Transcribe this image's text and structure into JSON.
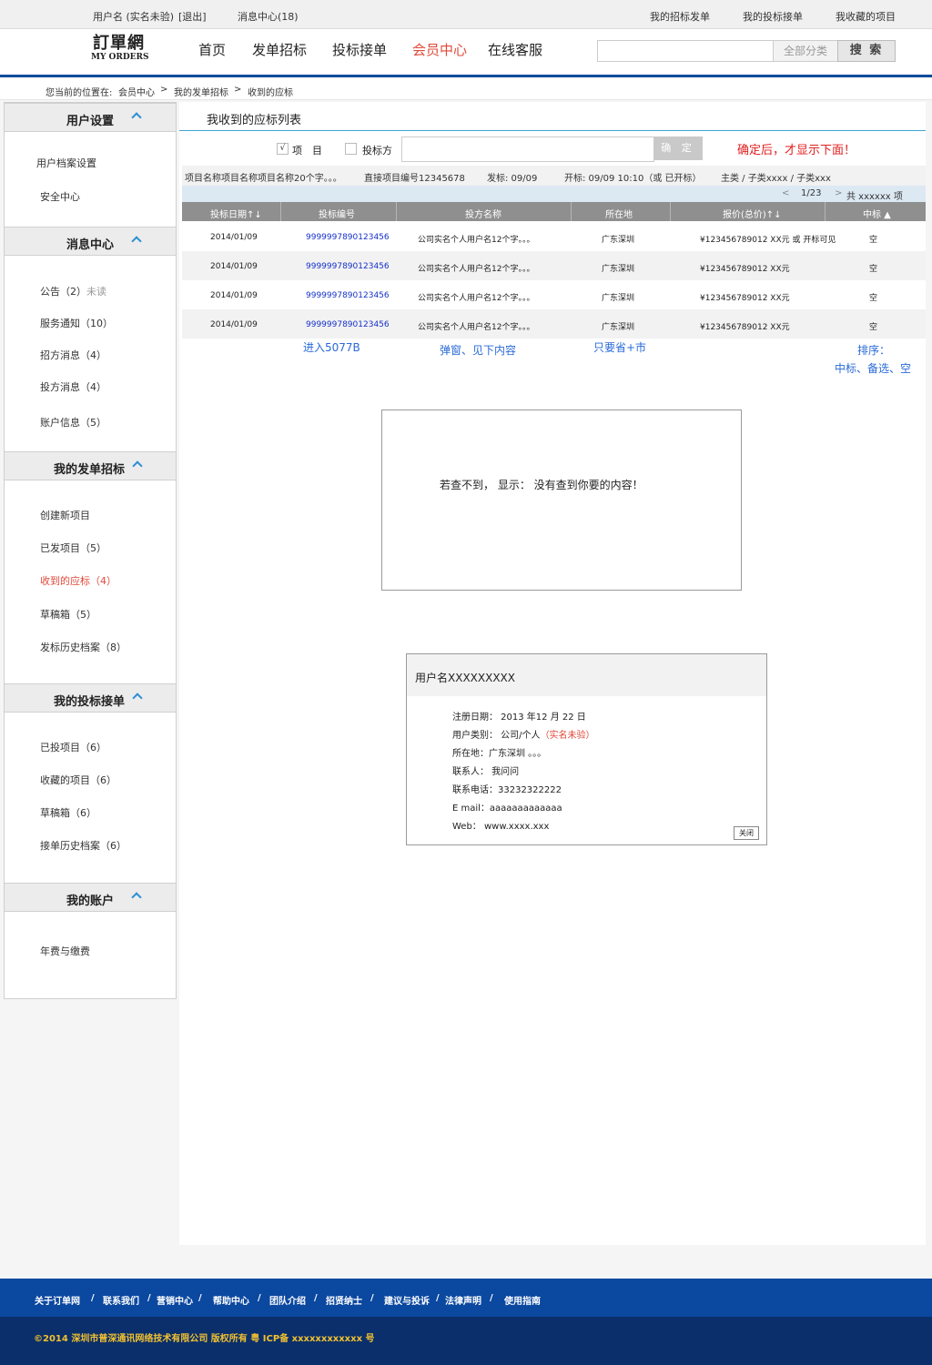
{
  "topbar": {
    "user": "用户名 (实名未验)",
    "logout": "[退出]",
    "messages": "消息中心(18)",
    "my_bids_posted": "我的招标发单",
    "my_bids_taken": "我的投标接单",
    "my_favorites": "我收藏的项目"
  },
  "logo": {
    "cn": "訂單網",
    "en": "MY ORDERS"
  },
  "nav": {
    "home": "首页",
    "post": "发单招标",
    "bid": "投标接单",
    "member": "会员中心",
    "service": "在线客服"
  },
  "search": {
    "category": "全部分类",
    "button": "搜 索"
  },
  "breadcrumb": {
    "prefix": "您当前的位置在:",
    "level1": "会员中心",
    "level2": "我的发单招标",
    "level3": "收到的应标",
    "sep": ">"
  },
  "sidebar": {
    "s1": {
      "title": "用户设置",
      "items": [
        "用户档案设置",
        "安全中心"
      ]
    },
    "s2": {
      "title": "消息中心",
      "items": [
        "公告（2）",
        "服务通知（10）",
        "招方消息（4）",
        "投方消息（4）",
        "账户信息（5）"
      ],
      "unread": "未读"
    },
    "s3": {
      "title": "我的发单招标",
      "items": [
        "创建新项目",
        "已发项目（5）",
        "收到的应标（4）",
        "草稿箱（5）",
        "发标历史档案（8）"
      ]
    },
    "s4": {
      "title": "我的投标接单",
      "items": [
        "已投项目（6）",
        "收藏的项目（6）",
        "草稿箱（6）",
        "接单历史档案（6）"
      ]
    },
    "s5": {
      "title": "我的账户",
      "items": [
        "年费与缴费"
      ]
    }
  },
  "main": {
    "title": "我收到的应标列表",
    "filter": {
      "check1_mark": "√",
      "check1_label": "项　目",
      "check2_label": "投标方",
      "ok_button": "确 定",
      "note": "确定后，才显示下面！"
    },
    "project_info": {
      "name": "项目名称项目名称项目名称20个字。。。",
      "code": "直接项目编号12345678",
      "publish": "发标: 09/09",
      "open": "开标: 09/09  10:10（或 已开标）",
      "category": "主类 / 子类xxxx  / 子类xxx"
    },
    "pager": {
      "prev": "<",
      "page": "1/23",
      "next": ">",
      "total": "共  xxxxxx  项"
    },
    "table": {
      "headers": [
        "投标日期↑↓",
        "投标编号",
        "投方名称",
        "所在地",
        "报价(总价)↑↓",
        "中标 ▲"
      ],
      "rows": [
        [
          "2014/01/09",
          "9999997890123456",
          "公司实名个人用户名12个字。。。",
          "广东深圳",
          "¥123456789012   XX元 或 开标可见",
          "空"
        ],
        [
          "2014/01/09",
          "9999997890123456",
          "公司实名个人用户名12个字。。。",
          "广东深圳",
          "¥123456789012   XX元",
          "空"
        ],
        [
          "2014/01/09",
          "9999997890123456",
          "公司实名个人用户名12个字。。。",
          "广东深圳",
          "¥123456789012   XX元",
          "空"
        ],
        [
          "2014/01/09",
          "9999997890123456",
          "公司实名个人用户名12个字。。。",
          "广东深圳",
          "¥123456789012   XX元",
          "空"
        ]
      ]
    },
    "annotations": {
      "enter": "进入5077B",
      "popup": "弹窗、见下内容",
      "province": "只要省+市",
      "sort": "排序：",
      "sort_opts": "中标、备选、空"
    },
    "empty_message": "若查不到，  显示：  没有查到你要的内容！",
    "popup": {
      "username": "用户名XXXXXXXXX",
      "reg_date": "注册日期： 2013   年12   月 22 日",
      "user_type": "用户类别： 公司/个人",
      "user_type_note": "（实名未验）",
      "location": "所在地：广东深圳 。。。",
      "contact": "联系人： 我问问",
      "phone": "联系电话：33232322222",
      "email": "E mail：aaaaaaaaaaaaa",
      "web": "Web：   www.xxxx.xxx",
      "close": "关闭"
    }
  },
  "footer": {
    "links": [
      "关于订单网",
      "/",
      "联系我们",
      "/",
      "营销中心",
      "/",
      "帮助中心",
      "/",
      "团队介绍",
      "/",
      "招贤纳士",
      "/",
      "建议与投诉",
      "/",
      "法律声明",
      "/",
      "使用指南"
    ],
    "copyright": "©2014 深圳市普深通讯网络技术有限公司 版权所有 粤 ICP备 xxxxxxxxxxxx 号"
  }
}
